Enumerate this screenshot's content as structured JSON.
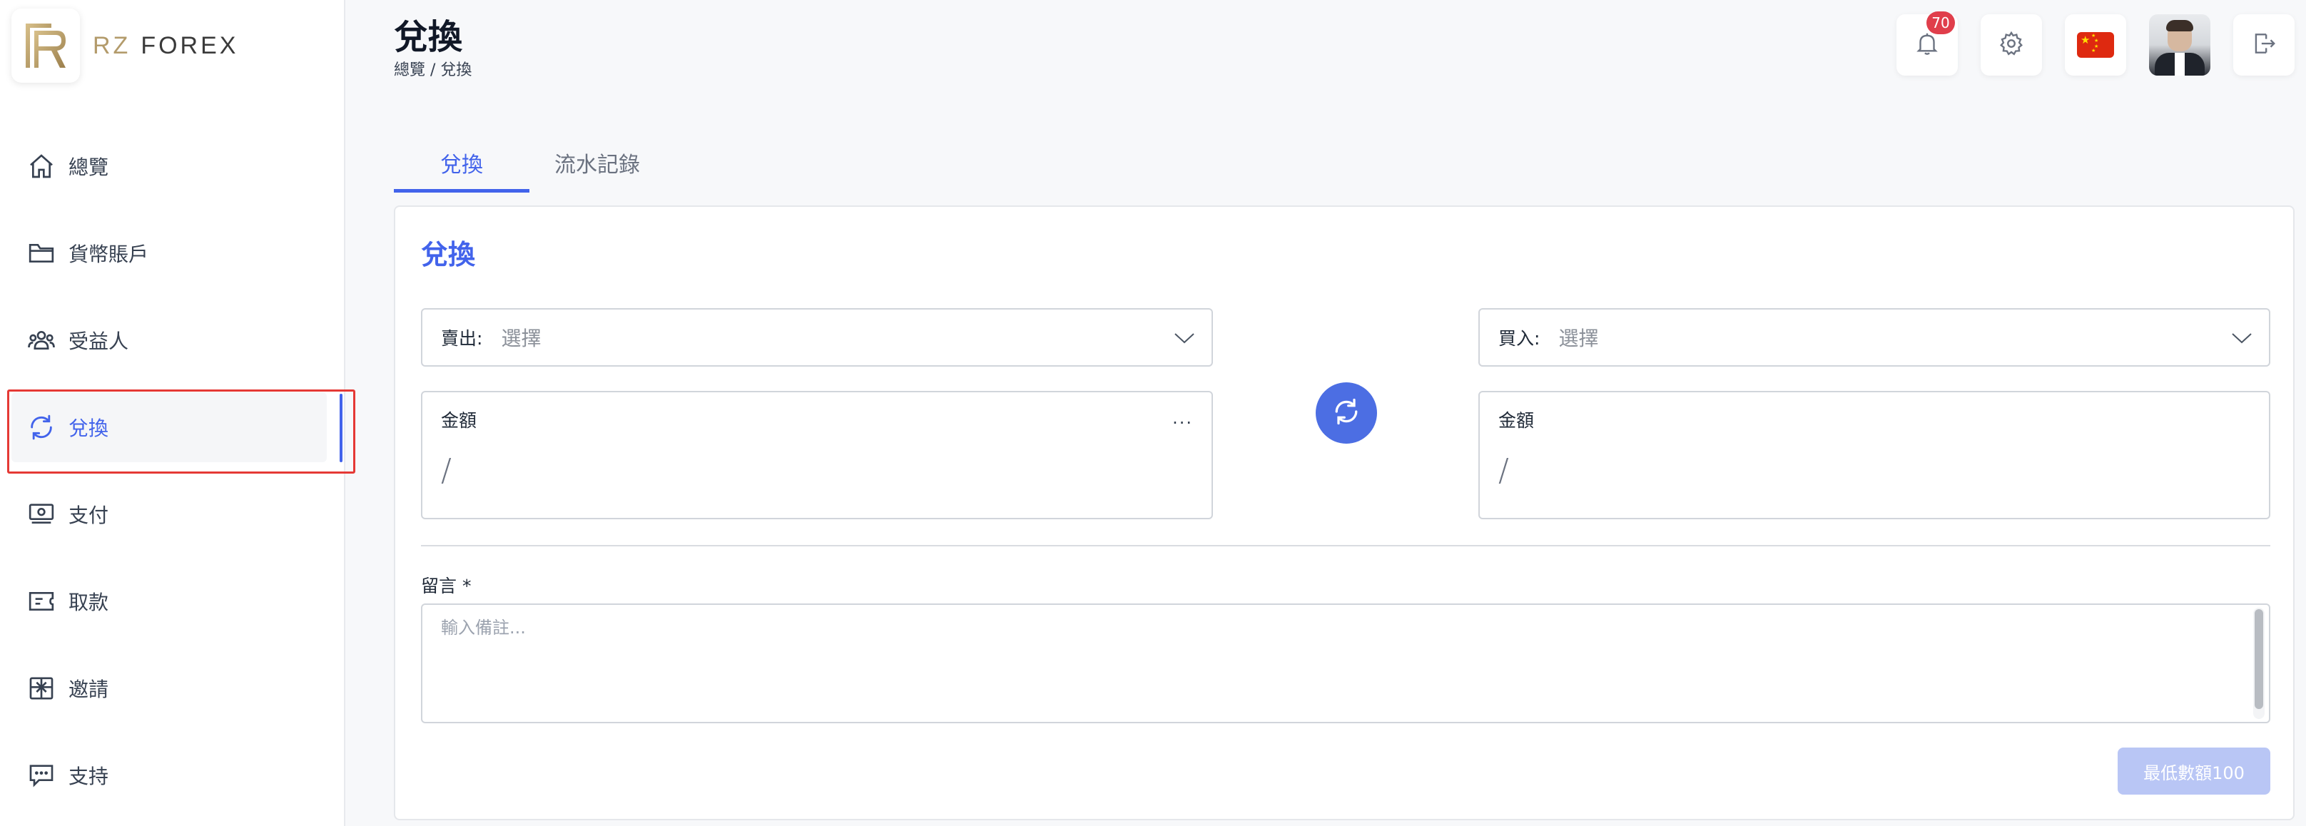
{
  "app": {
    "logo_prefix": "RZ",
    "logo_name": "FOREX"
  },
  "sidebar": {
    "items": [
      {
        "label": "總覽",
        "icon": "home-icon"
      },
      {
        "label": "貨幣賬戶",
        "icon": "folder-icon"
      },
      {
        "label": "受益人",
        "icon": "users-icon"
      },
      {
        "label": "兌換",
        "icon": "refresh-icon",
        "active": true
      },
      {
        "label": "支付",
        "icon": "cash-icon"
      },
      {
        "label": "取款",
        "icon": "ticket-icon"
      },
      {
        "label": "邀請",
        "icon": "gift-icon"
      },
      {
        "label": "支持",
        "icon": "chat-icon"
      }
    ]
  },
  "header": {
    "title": "兌換",
    "breadcrumb": "總覽 / 兌換",
    "notification_count": "70",
    "language_flag": "china-flag"
  },
  "tabs": [
    {
      "label": "兌換",
      "active": true
    },
    {
      "label": "流水記錄",
      "active": false
    }
  ],
  "form": {
    "title": "兌換",
    "sell": {
      "label": "賣出:",
      "value": "選擇"
    },
    "buy": {
      "label": "買入:",
      "value": "選擇"
    },
    "sell_amount": {
      "label": "金額",
      "more": "...",
      "value": "/"
    },
    "buy_amount": {
      "label": "金額",
      "value": "/"
    },
    "note": {
      "label": "留言 *",
      "placeholder": "輸入備註..."
    },
    "submit_label": "最低數額100"
  },
  "colors": {
    "accent": "#4263eb",
    "badge": "#e03e4b",
    "highlight": "#e53935",
    "submit_disabled": "#b9c6f5"
  }
}
